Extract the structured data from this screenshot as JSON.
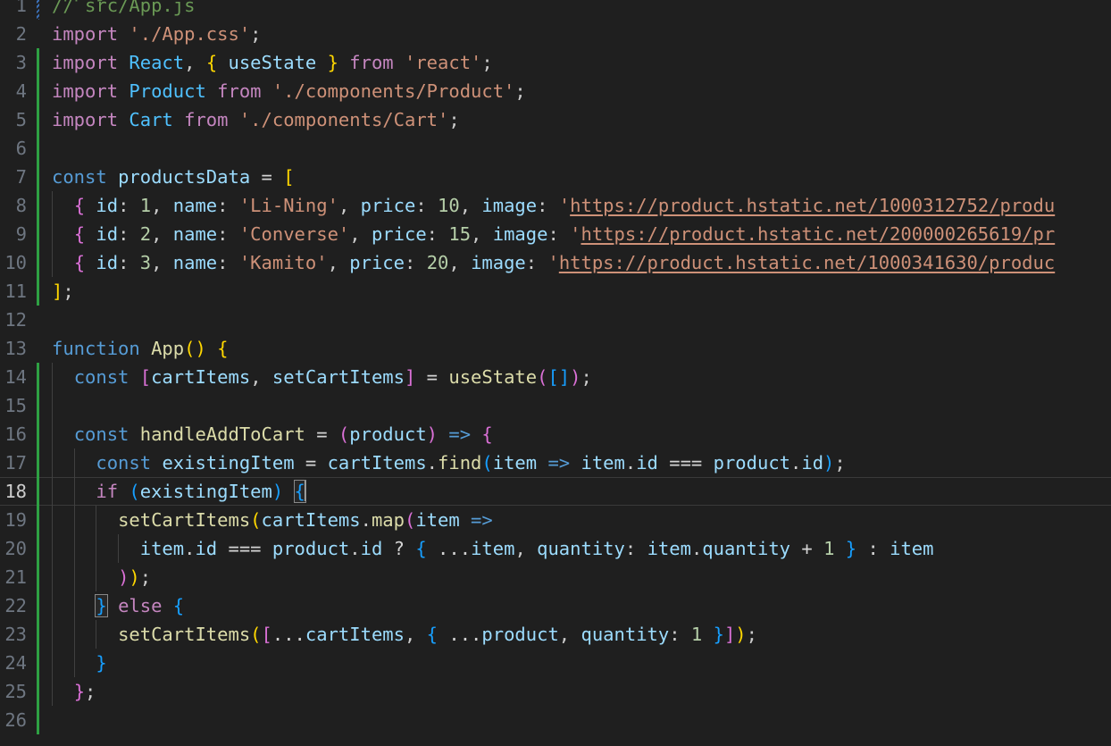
{
  "editor": {
    "language": "javascript",
    "file_comment": "// src/App.js",
    "theme": "dark-plus",
    "colors": {
      "background": "#1f1f1f",
      "foreground": "#cccccc",
      "line_number": "#6e7681",
      "active_line_number": "#cccccc",
      "comment": "#6a9955",
      "keyword": "#c586c0",
      "storage": "#569cd6",
      "string": "#ce9178",
      "number": "#b5cea8",
      "function": "#dcdcaa",
      "variable": "#9cdcfe",
      "component": "#4fc1ff",
      "bracket_1": "#ffd700",
      "bracket_2": "#da70d6",
      "bracket_3": "#179fff",
      "git_added": "#2ea043",
      "cursor": "#aeafad",
      "indent_guide": "#404040"
    },
    "cursor": {
      "line": 18,
      "column": 25
    },
    "active_line": 18
  },
  "clipped_top_line": {
    "text": "App.js",
    "visible": true
  },
  "lines": [
    {
      "n": 1,
      "git": "conflict",
      "indents": 0,
      "tokens": [
        {
          "t": "// src/App.js",
          "c": "cmt"
        }
      ]
    },
    {
      "n": 2,
      "git": "none",
      "indents": 0,
      "tokens": [
        {
          "t": "import",
          "c": "kw"
        },
        {
          "t": " ",
          "c": "plain"
        },
        {
          "t": "'./App.css'",
          "c": "str"
        },
        {
          "t": ";",
          "c": "plain"
        }
      ]
    },
    {
      "n": 3,
      "git": "added",
      "indents": 0,
      "tokens": [
        {
          "t": "import",
          "c": "kw"
        },
        {
          "t": " ",
          "c": "plain"
        },
        {
          "t": "React",
          "c": "comp"
        },
        {
          "t": ", ",
          "c": "plain"
        },
        {
          "t": "{",
          "c": "p1"
        },
        {
          "t": " ",
          "c": "plain"
        },
        {
          "t": "useState",
          "c": "var"
        },
        {
          "t": " ",
          "c": "plain"
        },
        {
          "t": "}",
          "c": "p1"
        },
        {
          "t": " ",
          "c": "plain"
        },
        {
          "t": "from",
          "c": "kw"
        },
        {
          "t": " ",
          "c": "plain"
        },
        {
          "t": "'react'",
          "c": "str"
        },
        {
          "t": ";",
          "c": "plain"
        }
      ]
    },
    {
      "n": 4,
      "git": "added",
      "indents": 0,
      "tokens": [
        {
          "t": "import",
          "c": "kw"
        },
        {
          "t": " ",
          "c": "plain"
        },
        {
          "t": "Product",
          "c": "comp"
        },
        {
          "t": " ",
          "c": "plain"
        },
        {
          "t": "from",
          "c": "kw"
        },
        {
          "t": " ",
          "c": "plain"
        },
        {
          "t": "'./components/Product'",
          "c": "str"
        },
        {
          "t": ";",
          "c": "plain"
        }
      ]
    },
    {
      "n": 5,
      "git": "added",
      "indents": 0,
      "tokens": [
        {
          "t": "import",
          "c": "kw"
        },
        {
          "t": " ",
          "c": "plain"
        },
        {
          "t": "Cart",
          "c": "comp"
        },
        {
          "t": " ",
          "c": "plain"
        },
        {
          "t": "from",
          "c": "kw"
        },
        {
          "t": " ",
          "c": "plain"
        },
        {
          "t": "'./components/Cart'",
          "c": "str"
        },
        {
          "t": ";",
          "c": "plain"
        }
      ]
    },
    {
      "n": 6,
      "git": "added",
      "indents": 0,
      "tokens": []
    },
    {
      "n": 7,
      "git": "added",
      "indents": 0,
      "tokens": [
        {
          "t": "const",
          "c": "kw2"
        },
        {
          "t": " ",
          "c": "plain"
        },
        {
          "t": "productsData",
          "c": "var"
        },
        {
          "t": " ",
          "c": "plain"
        },
        {
          "t": "=",
          "c": "op"
        },
        {
          "t": " ",
          "c": "plain"
        },
        {
          "t": "[",
          "c": "p1"
        }
      ]
    },
    {
      "n": 8,
      "git": "added",
      "indents": 1,
      "tokens": [
        {
          "t": "  ",
          "c": "plain"
        },
        {
          "t": "{",
          "c": "p2"
        },
        {
          "t": " ",
          "c": "plain"
        },
        {
          "t": "id",
          "c": "var"
        },
        {
          "t": ": ",
          "c": "plain"
        },
        {
          "t": "1",
          "c": "num"
        },
        {
          "t": ", ",
          "c": "plain"
        },
        {
          "t": "name",
          "c": "var"
        },
        {
          "t": ": ",
          "c": "plain"
        },
        {
          "t": "'Li-Ning'",
          "c": "str"
        },
        {
          "t": ", ",
          "c": "plain"
        },
        {
          "t": "price",
          "c": "var"
        },
        {
          "t": ": ",
          "c": "plain"
        },
        {
          "t": "10",
          "c": "num"
        },
        {
          "t": ", ",
          "c": "plain"
        },
        {
          "t": "image",
          "c": "var"
        },
        {
          "t": ": ",
          "c": "plain"
        },
        {
          "t": "'",
          "c": "str"
        },
        {
          "t": "https://product.hstatic.net/1000312752/produ",
          "c": "link"
        }
      ]
    },
    {
      "n": 9,
      "git": "added",
      "indents": 1,
      "tokens": [
        {
          "t": "  ",
          "c": "plain"
        },
        {
          "t": "{",
          "c": "p2"
        },
        {
          "t": " ",
          "c": "plain"
        },
        {
          "t": "id",
          "c": "var"
        },
        {
          "t": ": ",
          "c": "plain"
        },
        {
          "t": "2",
          "c": "num"
        },
        {
          "t": ", ",
          "c": "plain"
        },
        {
          "t": "name",
          "c": "var"
        },
        {
          "t": ": ",
          "c": "plain"
        },
        {
          "t": "'Converse'",
          "c": "str"
        },
        {
          "t": ", ",
          "c": "plain"
        },
        {
          "t": "price",
          "c": "var"
        },
        {
          "t": ": ",
          "c": "plain"
        },
        {
          "t": "15",
          "c": "num"
        },
        {
          "t": ", ",
          "c": "plain"
        },
        {
          "t": "image",
          "c": "var"
        },
        {
          "t": ": ",
          "c": "plain"
        },
        {
          "t": "'",
          "c": "str"
        },
        {
          "t": "https://product.hstatic.net/200000265619/pr",
          "c": "link"
        }
      ]
    },
    {
      "n": 10,
      "git": "added",
      "indents": 1,
      "tokens": [
        {
          "t": "  ",
          "c": "plain"
        },
        {
          "t": "{",
          "c": "p2"
        },
        {
          "t": " ",
          "c": "plain"
        },
        {
          "t": "id",
          "c": "var"
        },
        {
          "t": ": ",
          "c": "plain"
        },
        {
          "t": "3",
          "c": "num"
        },
        {
          "t": ", ",
          "c": "plain"
        },
        {
          "t": "name",
          "c": "var"
        },
        {
          "t": ": ",
          "c": "plain"
        },
        {
          "t": "'Kamito'",
          "c": "str"
        },
        {
          "t": ", ",
          "c": "plain"
        },
        {
          "t": "price",
          "c": "var"
        },
        {
          "t": ": ",
          "c": "plain"
        },
        {
          "t": "20",
          "c": "num"
        },
        {
          "t": ", ",
          "c": "plain"
        },
        {
          "t": "image",
          "c": "var"
        },
        {
          "t": ": ",
          "c": "plain"
        },
        {
          "t": "'",
          "c": "str"
        },
        {
          "t": "https://product.hstatic.net/1000341630/produc",
          "c": "link"
        }
      ]
    },
    {
      "n": 11,
      "git": "added",
      "indents": 0,
      "tokens": [
        {
          "t": "]",
          "c": "p1"
        },
        {
          "t": ";",
          "c": "plain"
        }
      ]
    },
    {
      "n": 12,
      "git": "none",
      "indents": 0,
      "tokens": []
    },
    {
      "n": 13,
      "git": "none",
      "indents": 0,
      "tokens": [
        {
          "t": "function",
          "c": "kw2"
        },
        {
          "t": " ",
          "c": "plain"
        },
        {
          "t": "App",
          "c": "fn"
        },
        {
          "t": "(",
          "c": "p1"
        },
        {
          "t": ")",
          "c": "p1"
        },
        {
          "t": " ",
          "c": "plain"
        },
        {
          "t": "{",
          "c": "p1"
        }
      ]
    },
    {
      "n": 14,
      "git": "added",
      "indents": 1,
      "tokens": [
        {
          "t": "  ",
          "c": "plain"
        },
        {
          "t": "const",
          "c": "kw2"
        },
        {
          "t": " ",
          "c": "plain"
        },
        {
          "t": "[",
          "c": "p2"
        },
        {
          "t": "cartItems",
          "c": "var"
        },
        {
          "t": ", ",
          "c": "plain"
        },
        {
          "t": "setCartItems",
          "c": "var"
        },
        {
          "t": "]",
          "c": "p2"
        },
        {
          "t": " ",
          "c": "plain"
        },
        {
          "t": "=",
          "c": "op"
        },
        {
          "t": " ",
          "c": "plain"
        },
        {
          "t": "useState",
          "c": "fn"
        },
        {
          "t": "(",
          "c": "p2"
        },
        {
          "t": "[",
          "c": "p3"
        },
        {
          "t": "]",
          "c": "p3"
        },
        {
          "t": ")",
          "c": "p2"
        },
        {
          "t": ";",
          "c": "plain"
        }
      ]
    },
    {
      "n": 15,
      "git": "added",
      "indents": 1,
      "tokens": []
    },
    {
      "n": 16,
      "git": "added",
      "indents": 1,
      "tokens": [
        {
          "t": "  ",
          "c": "plain"
        },
        {
          "t": "const",
          "c": "kw2"
        },
        {
          "t": " ",
          "c": "plain"
        },
        {
          "t": "handleAddToCart",
          "c": "fn"
        },
        {
          "t": " ",
          "c": "plain"
        },
        {
          "t": "=",
          "c": "op"
        },
        {
          "t": " ",
          "c": "plain"
        },
        {
          "t": "(",
          "c": "p2"
        },
        {
          "t": "product",
          "c": "var"
        },
        {
          "t": ")",
          "c": "p2"
        },
        {
          "t": " ",
          "c": "plain"
        },
        {
          "t": "=>",
          "c": "kw2"
        },
        {
          "t": " ",
          "c": "plain"
        },
        {
          "t": "{",
          "c": "p2"
        }
      ]
    },
    {
      "n": 17,
      "git": "added",
      "indents": 2,
      "tokens": [
        {
          "t": "    ",
          "c": "plain"
        },
        {
          "t": "const",
          "c": "kw2"
        },
        {
          "t": " ",
          "c": "plain"
        },
        {
          "t": "existingItem",
          "c": "var"
        },
        {
          "t": " ",
          "c": "plain"
        },
        {
          "t": "=",
          "c": "op"
        },
        {
          "t": " ",
          "c": "plain"
        },
        {
          "t": "cartItems",
          "c": "var"
        },
        {
          "t": ".",
          "c": "plain"
        },
        {
          "t": "find",
          "c": "fn"
        },
        {
          "t": "(",
          "c": "p3"
        },
        {
          "t": "item",
          "c": "var"
        },
        {
          "t": " ",
          "c": "plain"
        },
        {
          "t": "=>",
          "c": "kw2"
        },
        {
          "t": " ",
          "c": "plain"
        },
        {
          "t": "item",
          "c": "var"
        },
        {
          "t": ".",
          "c": "plain"
        },
        {
          "t": "id",
          "c": "var"
        },
        {
          "t": " ",
          "c": "plain"
        },
        {
          "t": "===",
          "c": "op"
        },
        {
          "t": " ",
          "c": "plain"
        },
        {
          "t": "product",
          "c": "var"
        },
        {
          "t": ".",
          "c": "plain"
        },
        {
          "t": "id",
          "c": "var"
        },
        {
          "t": ")",
          "c": "p3"
        },
        {
          "t": ";",
          "c": "plain"
        }
      ]
    },
    {
      "n": 18,
      "git": "added",
      "indents": 2,
      "active": true,
      "tokens": [
        {
          "t": "    ",
          "c": "plain"
        },
        {
          "t": "if",
          "c": "kw"
        },
        {
          "t": " ",
          "c": "plain"
        },
        {
          "t": "(",
          "c": "p3"
        },
        {
          "t": "existingItem",
          "c": "var"
        },
        {
          "t": ")",
          "c": "p3"
        },
        {
          "t": " ",
          "c": "plain"
        },
        {
          "t": "{",
          "c": "p3",
          "match": true
        },
        {
          "t": "CURSOR",
          "c": "cursor"
        }
      ]
    },
    {
      "n": 19,
      "git": "added",
      "indents": 3,
      "tokens": [
        {
          "t": "      ",
          "c": "plain"
        },
        {
          "t": "setCartItems",
          "c": "fn"
        },
        {
          "t": "(",
          "c": "p1"
        },
        {
          "t": "cartItems",
          "c": "var"
        },
        {
          "t": ".",
          "c": "plain"
        },
        {
          "t": "map",
          "c": "fn"
        },
        {
          "t": "(",
          "c": "p2"
        },
        {
          "t": "item",
          "c": "var"
        },
        {
          "t": " ",
          "c": "plain"
        },
        {
          "t": "=>",
          "c": "kw2"
        }
      ]
    },
    {
      "n": 20,
      "git": "added",
      "indents": 4,
      "tokens": [
        {
          "t": "        ",
          "c": "plain"
        },
        {
          "t": "item",
          "c": "var"
        },
        {
          "t": ".",
          "c": "plain"
        },
        {
          "t": "id",
          "c": "var"
        },
        {
          "t": " ",
          "c": "plain"
        },
        {
          "t": "===",
          "c": "op"
        },
        {
          "t": " ",
          "c": "plain"
        },
        {
          "t": "product",
          "c": "var"
        },
        {
          "t": ".",
          "c": "plain"
        },
        {
          "t": "id",
          "c": "var"
        },
        {
          "t": " ",
          "c": "plain"
        },
        {
          "t": "?",
          "c": "op"
        },
        {
          "t": " ",
          "c": "plain"
        },
        {
          "t": "{",
          "c": "p3"
        },
        {
          "t": " ",
          "c": "plain"
        },
        {
          "t": "...",
          "c": "op"
        },
        {
          "t": "item",
          "c": "var"
        },
        {
          "t": ", ",
          "c": "plain"
        },
        {
          "t": "quantity",
          "c": "var"
        },
        {
          "t": ": ",
          "c": "plain"
        },
        {
          "t": "item",
          "c": "var"
        },
        {
          "t": ".",
          "c": "plain"
        },
        {
          "t": "quantity",
          "c": "var"
        },
        {
          "t": " ",
          "c": "plain"
        },
        {
          "t": "+",
          "c": "op"
        },
        {
          "t": " ",
          "c": "plain"
        },
        {
          "t": "1",
          "c": "num"
        },
        {
          "t": " ",
          "c": "plain"
        },
        {
          "t": "}",
          "c": "p3"
        },
        {
          "t": " ",
          "c": "plain"
        },
        {
          "t": ":",
          "c": "op"
        },
        {
          "t": " ",
          "c": "plain"
        },
        {
          "t": "item",
          "c": "var"
        }
      ]
    },
    {
      "n": 21,
      "git": "added",
      "indents": 3,
      "tokens": [
        {
          "t": "      ",
          "c": "plain"
        },
        {
          "t": ")",
          "c": "p2"
        },
        {
          "t": ")",
          "c": "p1"
        },
        {
          "t": ";",
          "c": "plain"
        }
      ]
    },
    {
      "n": 22,
      "git": "added",
      "indents": 2,
      "tokens": [
        {
          "t": "    ",
          "c": "plain"
        },
        {
          "t": "}",
          "c": "p3",
          "match": true
        },
        {
          "t": " ",
          "c": "plain"
        },
        {
          "t": "else",
          "c": "kw"
        },
        {
          "t": " ",
          "c": "plain"
        },
        {
          "t": "{",
          "c": "p3"
        }
      ]
    },
    {
      "n": 23,
      "git": "added",
      "indents": 3,
      "tokens": [
        {
          "t": "      ",
          "c": "plain"
        },
        {
          "t": "setCartItems",
          "c": "fn"
        },
        {
          "t": "(",
          "c": "p1"
        },
        {
          "t": "[",
          "c": "p2"
        },
        {
          "t": "...",
          "c": "op"
        },
        {
          "t": "cartItems",
          "c": "var"
        },
        {
          "t": ", ",
          "c": "plain"
        },
        {
          "t": "{",
          "c": "p3"
        },
        {
          "t": " ",
          "c": "plain"
        },
        {
          "t": "...",
          "c": "op"
        },
        {
          "t": "product",
          "c": "var"
        },
        {
          "t": ", ",
          "c": "plain"
        },
        {
          "t": "quantity",
          "c": "var"
        },
        {
          "t": ": ",
          "c": "plain"
        },
        {
          "t": "1",
          "c": "num"
        },
        {
          "t": " ",
          "c": "plain"
        },
        {
          "t": "}",
          "c": "p3"
        },
        {
          "t": "]",
          "c": "p2"
        },
        {
          "t": ")",
          "c": "p1"
        },
        {
          "t": ";",
          "c": "plain"
        }
      ]
    },
    {
      "n": 24,
      "git": "added",
      "indents": 2,
      "tokens": [
        {
          "t": "    ",
          "c": "plain"
        },
        {
          "t": "}",
          "c": "p3"
        }
      ]
    },
    {
      "n": 25,
      "git": "added",
      "indents": 1,
      "tokens": [
        {
          "t": "  ",
          "c": "plain"
        },
        {
          "t": "}",
          "c": "p2"
        },
        {
          "t": ";",
          "c": "plain"
        }
      ]
    },
    {
      "n": 26,
      "git": "added",
      "indents": 0,
      "tokens": []
    }
  ]
}
